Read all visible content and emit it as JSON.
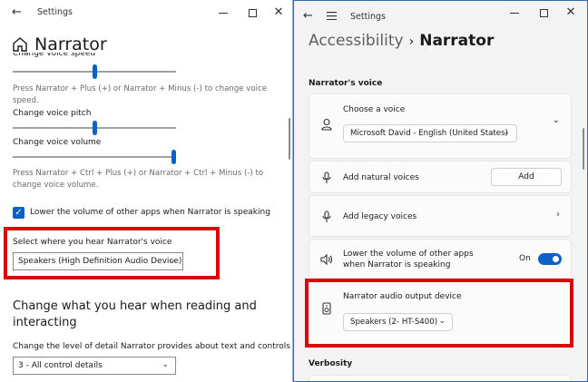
{
  "left_window": {
    "title": "Settings",
    "page_title": "Narrator",
    "voice_speed_label": "Change voice speed",
    "voice_speed_value": 0.5,
    "voice_speed_hint": "Press Narrator + Plus (+) or Narrator + Minus (-) to change voice speed.",
    "voice_pitch_label": "Change voice pitch",
    "voice_pitch_value": 0.5,
    "voice_volume_label": "Change voice volume",
    "voice_volume_value": 1.0,
    "voice_volume_hint": "Press Narrator + Ctrl + Plus (+) or Narrator + Ctrl + Minus (-) to change voice volume.",
    "lower_volume_checkbox": "Lower the volume of other apps when Narrator is speaking",
    "lower_volume_checked": true,
    "output_select_label": "Select where you hear Narrator's voice",
    "output_select_value": "Speakers (High Definition Audio Device)",
    "section_heading": "Change what you hear when reading and interacting",
    "detail_label": "Change the level of detail Narrator provides about text and controls",
    "detail_value": "3 - All control details"
  },
  "right_window": {
    "title": "Settings",
    "breadcrumb_parent": "Accessibility",
    "breadcrumb_separator": "›",
    "breadcrumb_current": "Narrator",
    "section_voice": "Narrator's voice",
    "choose_voice_label": "Choose a voice",
    "choose_voice_value": "Microsoft David - English (United States)",
    "natural_voices_label": "Add natural voices",
    "natural_voices_button": "Add",
    "legacy_voices_label": "Add legacy voices",
    "lower_volume_label": "Lower the volume of other apps when Narrator is speaking",
    "lower_volume_state": "On",
    "audio_output_label": "Narrator audio output device",
    "audio_output_value": "Speakers (2- HT-S400)",
    "section_verbosity": "Verbosity"
  },
  "colors": {
    "accent": "#0b62c4",
    "highlight_box": "#e0000c",
    "desktop": "#1f5fa8"
  }
}
